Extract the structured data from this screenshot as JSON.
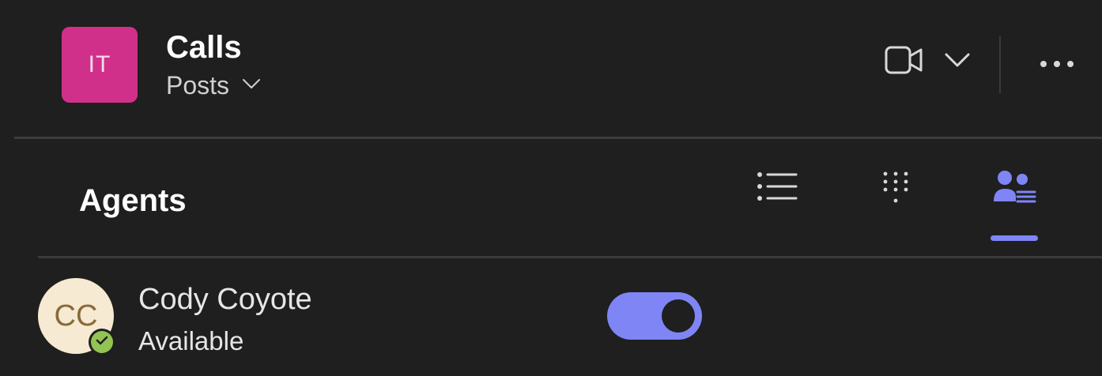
{
  "header": {
    "team_initials": "IT",
    "channel_title": "Calls",
    "current_tab": "Posts",
    "team_color": "#d1308a"
  },
  "icons": {
    "video": "video-camera-icon",
    "video_dropdown": "chevron-down-icon",
    "more": "more-options-icon",
    "tab_list": "list-icon",
    "tab_dialpad": "dialpad-icon",
    "tab_agents": "agents-icon",
    "presence": "checkmark-icon"
  },
  "agents_section": {
    "title": "Agents",
    "active_tab": "agents",
    "accent_color": "#7f85f5"
  },
  "agents": [
    {
      "initials": "CC",
      "name": "Cody Coyote",
      "status": "Available",
      "status_color": "#92c353",
      "enabled": true
    }
  ]
}
